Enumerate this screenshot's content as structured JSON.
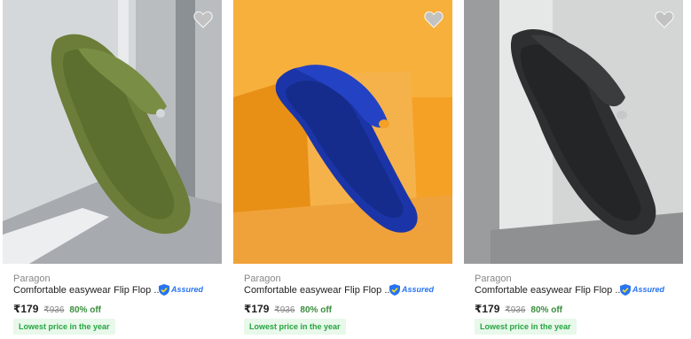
{
  "products": [
    {
      "brand": "Paragon",
      "title": "Comfortable easywear Flip Flop ...",
      "assured": "Assured",
      "price": "₹179",
      "mrp": "₹936",
      "discount": "80% off",
      "badge": "Lowest price in the year",
      "wishlist_icon": "heart-icon",
      "product_color": "#677a36",
      "background_color": "#c9cdd0"
    },
    {
      "brand": "Paragon",
      "title": "Comfortable easywear Flip Flop ...",
      "assured": "Assured",
      "price": "₹179",
      "mrp": "₹936",
      "discount": "80% off",
      "badge": "Lowest price in the year",
      "wishlist_icon": "heart-icon",
      "product_color": "#1b35a8",
      "background_color": "#f4a126"
    },
    {
      "brand": "Paragon",
      "title": "Comfortable easywear Flip Flop ...",
      "assured": "Assured",
      "price": "₹179",
      "mrp": "₹936",
      "discount": "80% off",
      "badge": "Lowest price in the year",
      "wishlist_icon": "heart-icon",
      "product_color": "#2d2f31",
      "background_color": "#c7c8c8"
    }
  ],
  "colors": {
    "price_discount": "#388e3c",
    "badge_text": "#26a541",
    "badge_bg": "#e8f8ea",
    "assured_blue": "#2874f0"
  }
}
